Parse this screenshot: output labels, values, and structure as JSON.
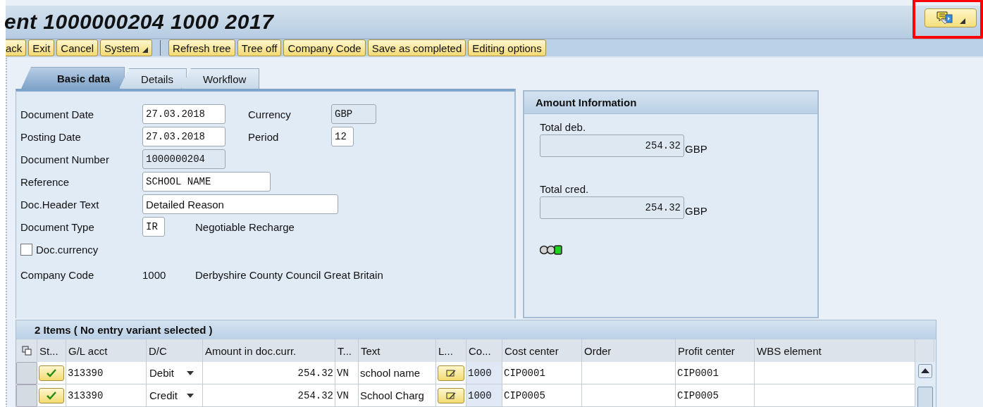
{
  "title": "ent 1000000204 1000 2017",
  "title_button": {
    "highlighted": true
  },
  "toolbar": [
    {
      "label": "ack",
      "menu": false
    },
    {
      "label": "Exit",
      "menu": false
    },
    {
      "label": "Cancel",
      "menu": false
    },
    {
      "label": "System",
      "menu": true
    },
    {
      "kind": "separator"
    },
    {
      "label": "Refresh tree",
      "menu": false
    },
    {
      "label": "Tree off",
      "menu": false
    },
    {
      "label": "Company Code",
      "menu": false
    },
    {
      "label": "Save as completed",
      "menu": false
    },
    {
      "label": "Editing options",
      "menu": false
    }
  ],
  "tabs": [
    {
      "label": "Basic data",
      "selected": true
    },
    {
      "label": "Details",
      "selected": false
    },
    {
      "label": "Workflow",
      "selected": false
    }
  ],
  "form_rows": [
    {
      "label": "Document Date",
      "items": [
        {
          "kind": "input",
          "value": "27.03.2018",
          "editable": true
        },
        {
          "kind": "label",
          "text": "Currency"
        },
        {
          "kind": "input",
          "value": "GBP",
          "editable": false
        }
      ]
    },
    {
      "label": "Posting Date",
      "items": [
        {
          "kind": "input",
          "value": "27.03.2018",
          "editable": true
        },
        {
          "kind": "label",
          "text": "Period"
        },
        {
          "kind": "input",
          "value": "12",
          "editable": true
        }
      ]
    },
    {
      "label": "Document Number",
      "items": [
        {
          "kind": "input",
          "value": "1000000204",
          "editable": false
        }
      ]
    },
    {
      "label": "Reference",
      "items": [
        {
          "kind": "input",
          "value": "SCHOOL NAME",
          "editable": true
        }
      ]
    },
    {
      "label": "Doc.Header Text",
      "items": [
        {
          "kind": "input",
          "value": "Detailed Reason",
          "editable": true,
          "proportional": true
        }
      ]
    },
    {
      "label": "Document Type",
      "items": [
        {
          "kind": "input",
          "value": "IR",
          "editable": true
        },
        {
          "kind": "text",
          "text": "Negotiable Recharge"
        }
      ]
    },
    {
      "kind": "checkbox",
      "label": "Doc.currency",
      "checked": false
    },
    {
      "label": "Company Code",
      "items": [
        {
          "kind": "text",
          "text": "1000"
        },
        {
          "kind": "text",
          "text": "Derbyshire County Council Great Britain"
        }
      ]
    }
  ],
  "amount_info": {
    "title": "Amount Information",
    "totals": [
      {
        "label": "Total deb.",
        "value": "254.32",
        "currency": "GBP"
      },
      {
        "label": "Total cred.",
        "value": "254.32",
        "currency": "GBP"
      }
    ],
    "traffic_light": [
      {
        "on": false
      },
      {
        "on": false
      },
      {
        "on": true
      }
    ]
  },
  "items_table": {
    "title": "2 Items ( No entry variant selected )",
    "columns": [
      "St...",
      "G/L acct",
      "D/C",
      "Amount in doc.curr.",
      "T...",
      "Text",
      "L...",
      "Co...",
      "Cost center",
      "Order",
      "Profit center",
      "WBS element"
    ],
    "rows": [
      {
        "status_ok": true,
        "gl_acct": "313390",
        "dc": "Debit",
        "amount": "254.32",
        "t": "VN",
        "text": "school name",
        "co": "1000",
        "cost_center": "CIP0001",
        "profit_center": "CIP0001"
      },
      {
        "status_ok": true,
        "gl_acct": "313390",
        "dc": "Credit",
        "amount": "254.32",
        "t": "VN",
        "text": "School Charg",
        "co": "1000",
        "cost_center": "CIP0005",
        "profit_center": "CIP0005"
      }
    ]
  }
}
